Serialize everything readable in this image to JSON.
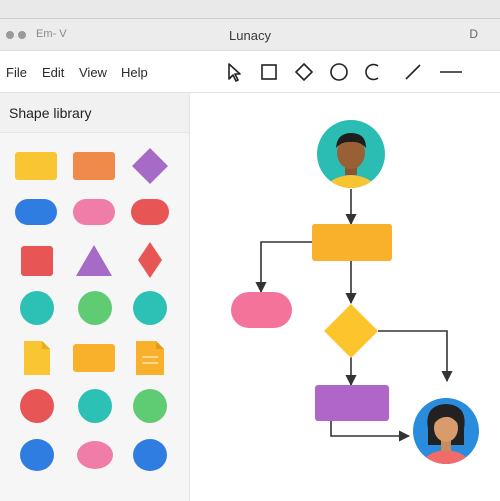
{
  "window": {
    "title": "Lunacy",
    "title_left": "Em- V",
    "title_right": "D"
  },
  "menu": {
    "file": "File",
    "edit": "Edit",
    "view": "View",
    "help": "Help"
  },
  "toolbar": {
    "tools": [
      "pointer-tool",
      "rectangle-tool",
      "diamond-tool",
      "ellipse-tool",
      "arc-tool",
      "line-tool",
      "divider-line-tool"
    ]
  },
  "sidebar": {
    "title": "Shape library",
    "shapes": [
      [
        "yellow rectangle",
        "orange rectangle",
        "purple diamond"
      ],
      [
        "blue pill",
        "pink pill",
        "red pill"
      ],
      [
        "red square",
        "purple triangle",
        "red diamond"
      ],
      [
        "teal circle",
        "green circle",
        "teal circle"
      ],
      [
        "yellow document",
        "orange rectangle",
        "orange document"
      ],
      [
        "red circle",
        "teal circle",
        "green circle"
      ],
      [
        "blue circle",
        "pink ellipse",
        "blue circle"
      ]
    ]
  },
  "colors": {
    "yellow": "#f9c532",
    "orange": "#f08a4b",
    "purple": "#a66ac7",
    "blue": "#2f7de1",
    "pink": "#f07ca8",
    "red": "#e85555",
    "teal": "#2cc1b4",
    "green": "#5fcb73",
    "flow_orange": "#f9b02a",
    "flow_pink": "#f4739a",
    "flow_yellow": "#fcc52b",
    "flow_purple": "#b066c8",
    "avatar_teal": "#2bbdb4",
    "avatar_blue": "#2a8cdc"
  }
}
